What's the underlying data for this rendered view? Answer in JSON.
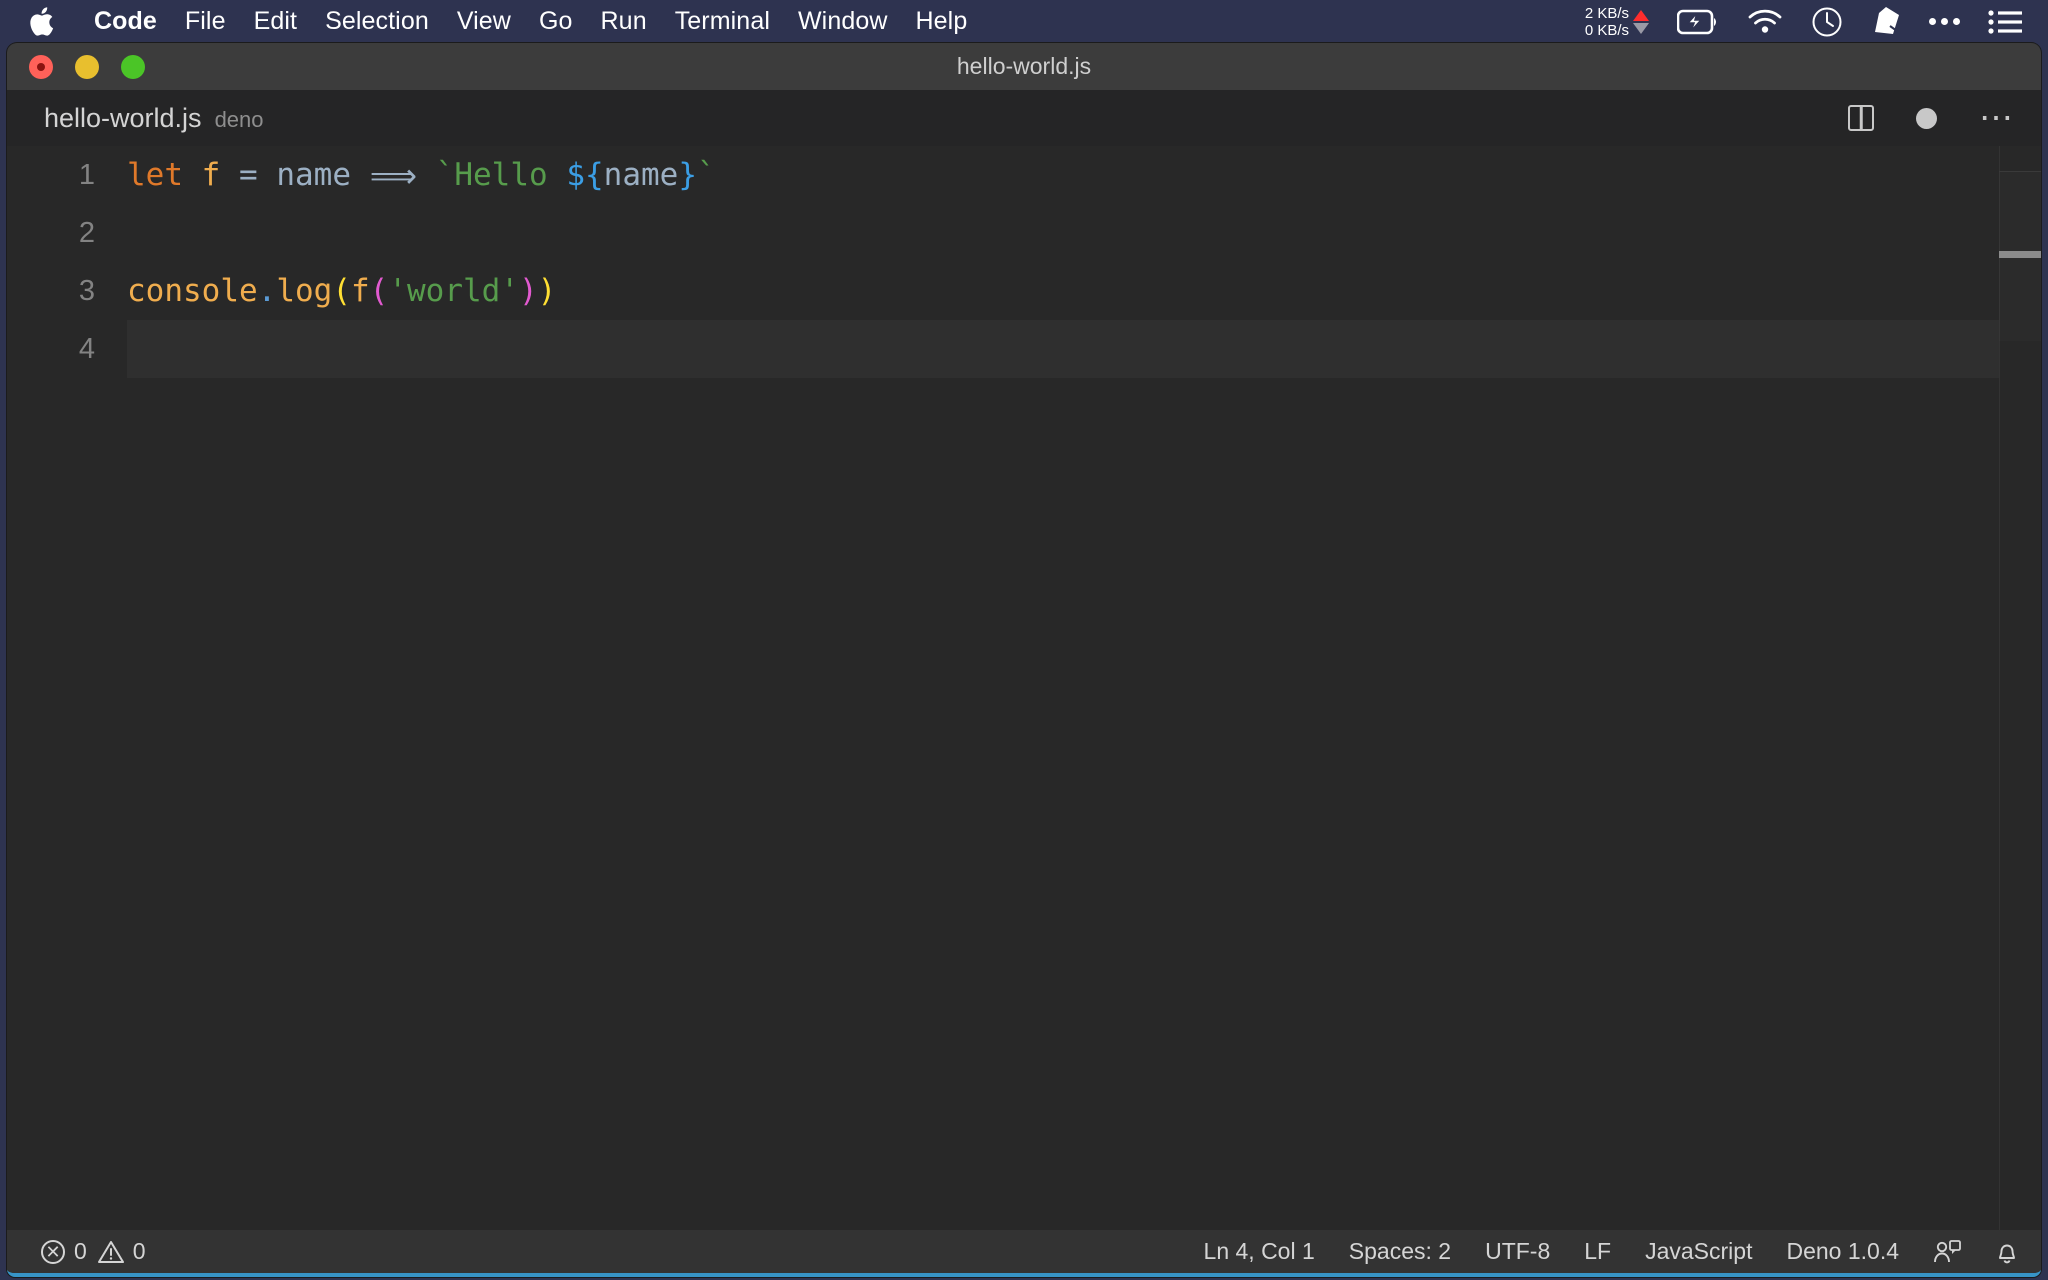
{
  "menubar": {
    "apple_icon": "apple-logo-icon",
    "items": [
      {
        "label": "Code",
        "bold": true
      },
      {
        "label": "File",
        "bold": false
      },
      {
        "label": "Edit",
        "bold": false
      },
      {
        "label": "Selection",
        "bold": false
      },
      {
        "label": "View",
        "bold": false
      },
      {
        "label": "Go",
        "bold": false
      },
      {
        "label": "Run",
        "bold": false
      },
      {
        "label": "Terminal",
        "bold": false
      },
      {
        "label": "Window",
        "bold": false
      },
      {
        "label": "Help",
        "bold": false
      }
    ],
    "status": {
      "upload_rate": "2 KB/s",
      "download_rate": "0 KB/s",
      "upload_arrow_color": "#ff2d2d",
      "download_arrow_color": "#9a9aa6",
      "icons": [
        "battery-charging-icon",
        "wifi-icon",
        "clock-icon",
        "dropbox-icon",
        "ellipsis-icon",
        "control-center-list-icon"
      ]
    },
    "background_color": "#2e3350"
  },
  "window": {
    "title": "hello-world.js",
    "traffic_lights": [
      "close-button",
      "minimize-button",
      "maximize-button"
    ],
    "accent_border_color": "#3794c7"
  },
  "breadcrumb": {
    "file": "hello-world.js",
    "tag": "deno"
  },
  "editor_actions": {
    "split": "split-editor-icon",
    "dirty": "unsaved-dot-icon",
    "more": "more-actions-icon"
  },
  "code": {
    "language": "JavaScript",
    "lines": [
      {
        "number": "1",
        "active": false,
        "tokens": [
          {
            "text": "let",
            "cls": "tok-kw"
          },
          {
            "text": " ",
            "cls": "tok-op"
          },
          {
            "text": "f",
            "cls": "tok-fn"
          },
          {
            "text": " ",
            "cls": "tok-op"
          },
          {
            "text": "=",
            "cls": "tok-op"
          },
          {
            "text": " ",
            "cls": "tok-op"
          },
          {
            "text": "name",
            "cls": "tok-var"
          },
          {
            "text": " ",
            "cls": "tok-op"
          },
          {
            "text": "⟹",
            "cls": "tok-arrow"
          },
          {
            "text": " ",
            "cls": "tok-op"
          },
          {
            "text": "`Hello ",
            "cls": "tok-str"
          },
          {
            "text": "${",
            "cls": "tok-tpl"
          },
          {
            "text": "name",
            "cls": "tok-var"
          },
          {
            "text": "}",
            "cls": "tok-tpl"
          },
          {
            "text": "`",
            "cls": "tok-str"
          }
        ]
      },
      {
        "number": "2",
        "active": false,
        "tokens": []
      },
      {
        "number": "3",
        "active": false,
        "tokens": [
          {
            "text": "console",
            "cls": "tok-prop"
          },
          {
            "text": ".",
            "cls": "tok-dot"
          },
          {
            "text": "log",
            "cls": "tok-prop"
          },
          {
            "text": "(",
            "cls": "tok-paren-y"
          },
          {
            "text": "f",
            "cls": "tok-fn"
          },
          {
            "text": "(",
            "cls": "tok-paren-m"
          },
          {
            "text": "'world'",
            "cls": "tok-str"
          },
          {
            "text": ")",
            "cls": "tok-paren-m"
          },
          {
            "text": ")",
            "cls": "tok-paren-y"
          }
        ]
      },
      {
        "number": "4",
        "active": true,
        "tokens": []
      }
    ]
  },
  "statusbar": {
    "errors": "0",
    "warnings": "0",
    "position": "Ln 4, Col 1",
    "indentation": "Spaces: 2",
    "encoding": "UTF-8",
    "eol": "LF",
    "language": "JavaScript",
    "runtime": "Deno 1.0.4",
    "feedback_icon": "feedback-smiley-icon",
    "bell_icon": "notifications-bell-icon"
  }
}
